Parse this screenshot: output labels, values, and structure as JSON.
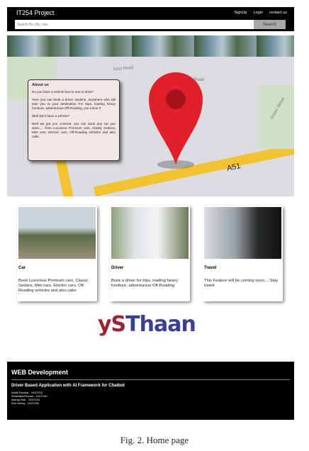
{
  "header": {
    "title": "IT254 Project",
    "nav": [
      "SignUp",
      "Login",
      "contact us"
    ],
    "search_placeholder": "Search By city, cars",
    "search_button": "Search"
  },
  "map": {
    "road_labels": [
      "East Road",
      "East Road",
      "Green Street",
      "A51"
    ]
  },
  "about": {
    "heading": "About us",
    "paragraphs": [
      "Do you have a vehicle but no one to drive?",
      "Here you can book a driver anytime, anywhere who will take you to your destination For trips, loading heavy furniture, adventurous Off-Roading, you name it",
      "Well don't have a vehicle?",
      "Well we got you covered, you can book any car you want..... from Luxurious Premium cars, Classy Sedans, Mini cars, Electric cars, Off-Roading vehicles and also cabs"
    ]
  },
  "cards": [
    {
      "title": "Car",
      "text": "Book Luxurious Premium cars, Classy Sedans, Mini cars, Electric cars, Off-Roading vehicles and also cabs"
    },
    {
      "title": "Driver",
      "text": "Book a driver for trips, loading heavy furniture, adventurous Off-Roading"
    },
    {
      "title": "Travel",
      "text": "This Feature will be coming soon.... Stay tuned"
    }
  ],
  "logo": "ySThaan",
  "footer": {
    "heading": "WEB Development",
    "subheading": "Driver Based Application with AI Framework for Chatbot",
    "members": [
      "Kartik Pavskar - 191IT223",
      "Shashikant Kumar - 191IT249",
      "Akshay Nair - 191IT103",
      "Shiv Dubey - 191IT250"
    ]
  },
  "caption": "Fig. 2.  Home page"
}
